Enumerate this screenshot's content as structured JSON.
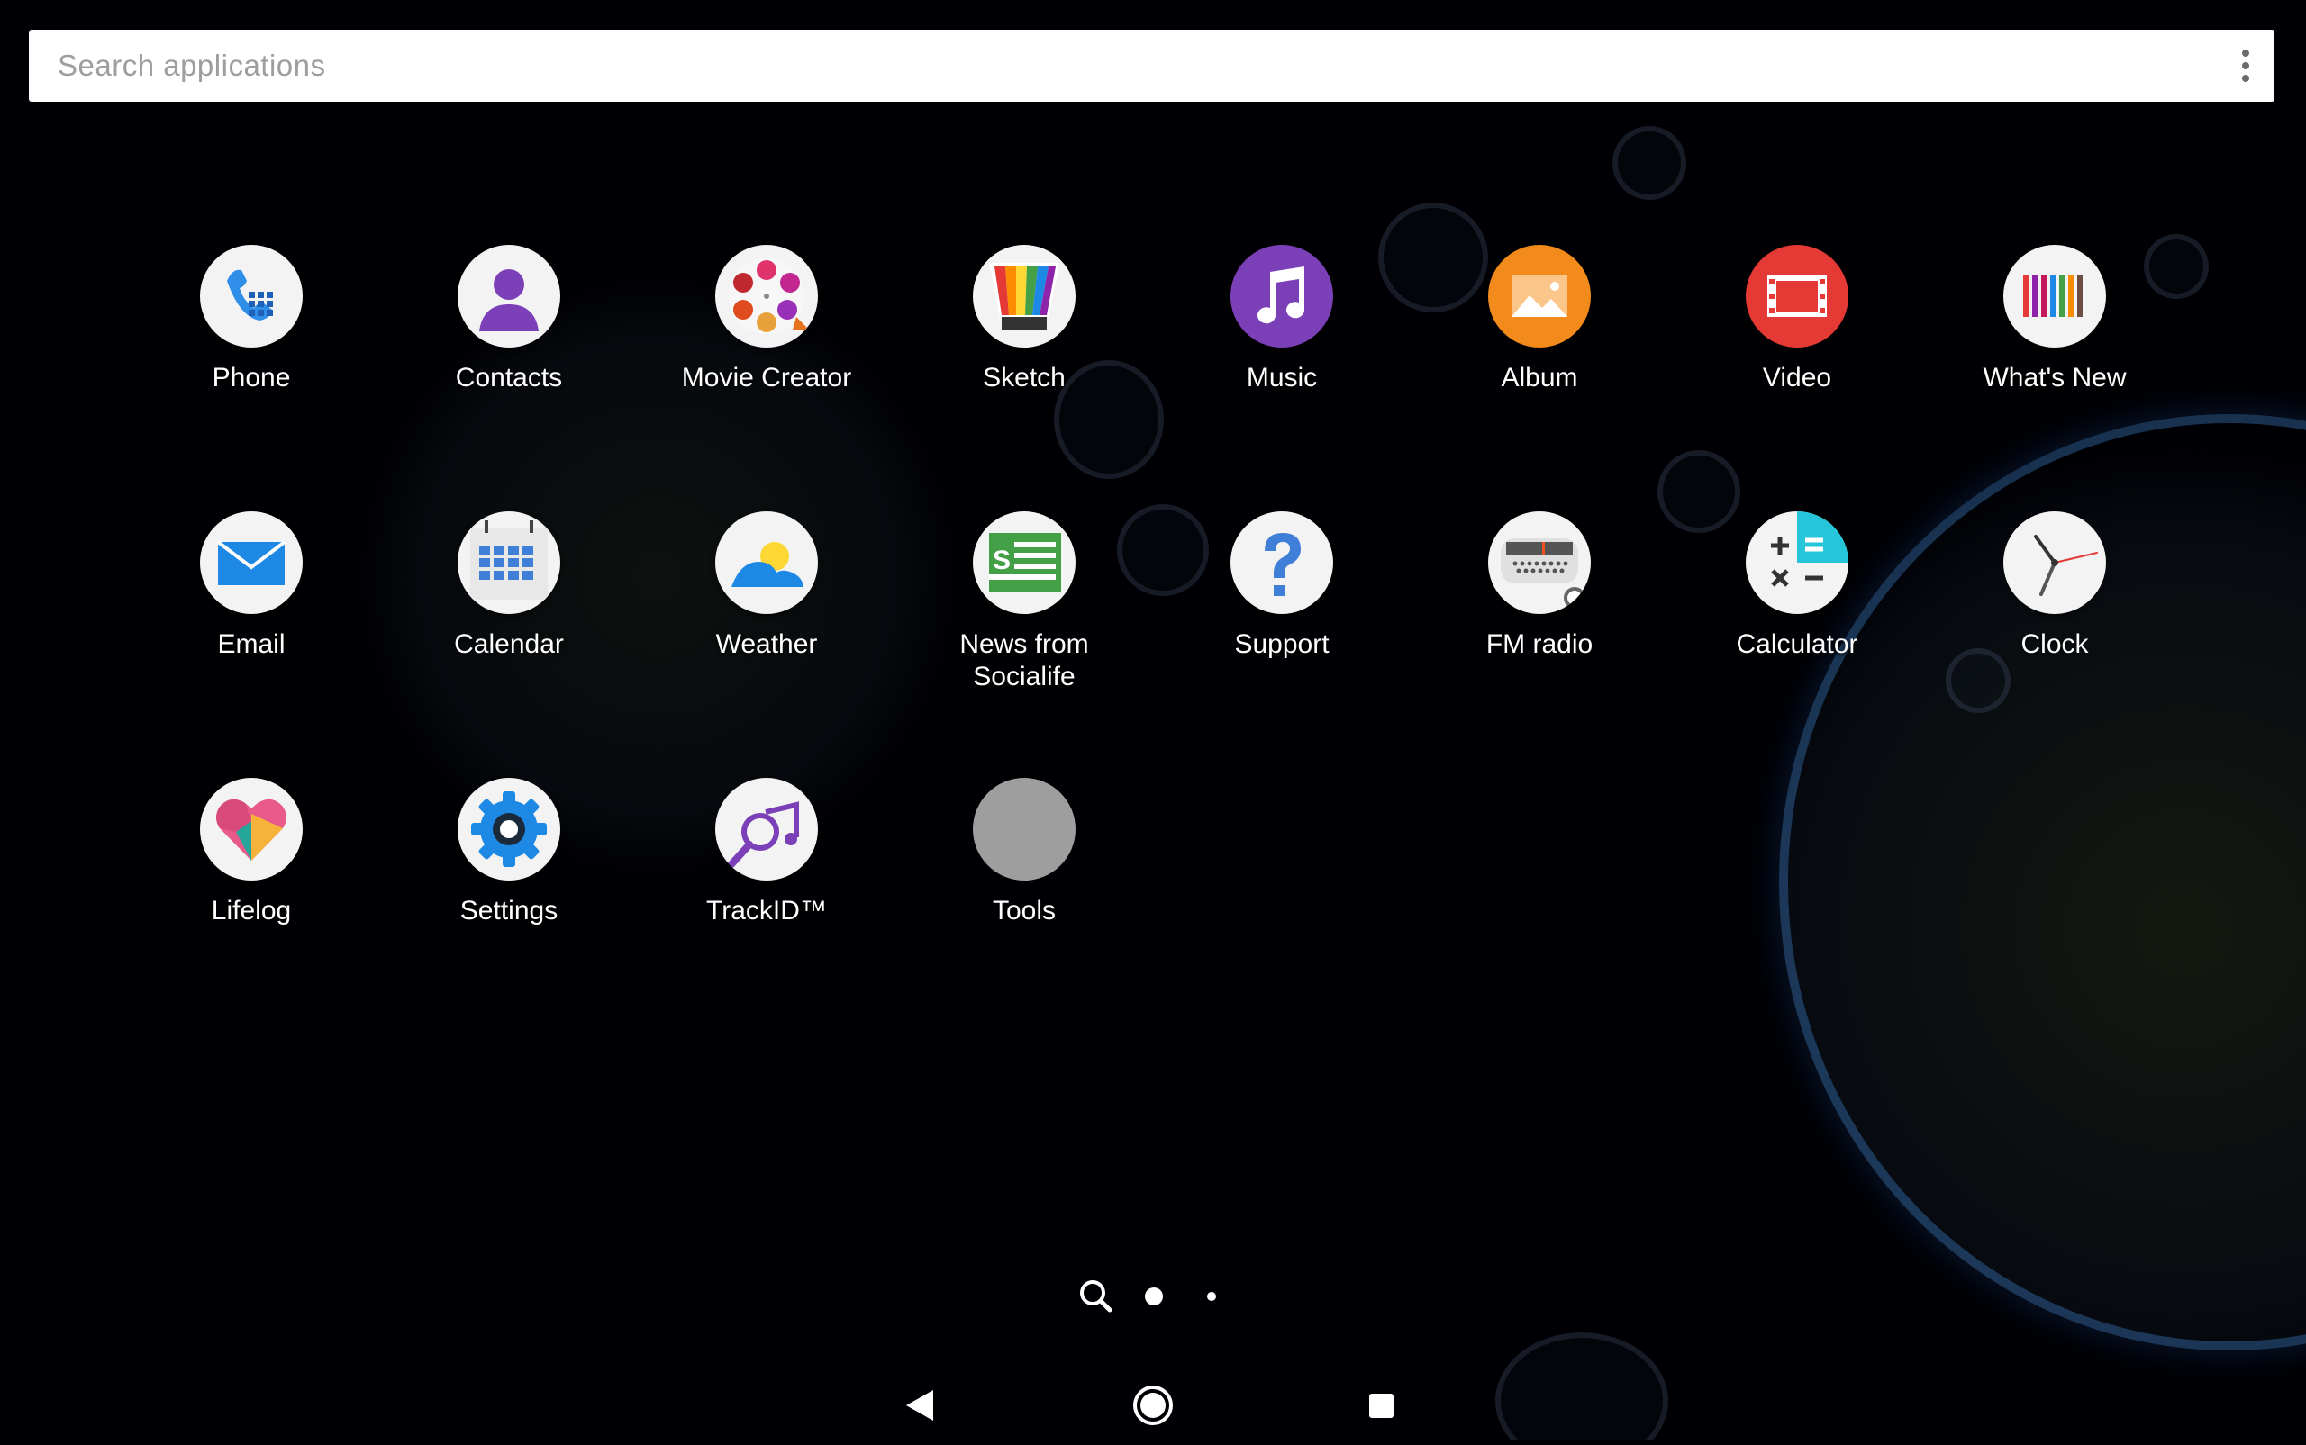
{
  "search": {
    "placeholder": "Search applications"
  },
  "apps": [
    {
      "label": "Phone",
      "icon": "phone-icon"
    },
    {
      "label": "Contacts",
      "icon": "contacts-icon"
    },
    {
      "label": "Movie Creator",
      "icon": "movie-creator-icon"
    },
    {
      "label": "Sketch",
      "icon": "sketch-icon"
    },
    {
      "label": "Music",
      "icon": "music-icon"
    },
    {
      "label": "Album",
      "icon": "album-icon"
    },
    {
      "label": "Video",
      "icon": "video-icon"
    },
    {
      "label": "What's New",
      "icon": "whats-new-icon"
    },
    {
      "label": "Email",
      "icon": "email-icon"
    },
    {
      "label": "Calendar",
      "icon": "calendar-icon"
    },
    {
      "label": "Weather",
      "icon": "weather-icon"
    },
    {
      "label": "News from Socialife",
      "icon": "news-socialife-icon"
    },
    {
      "label": "Support",
      "icon": "support-icon"
    },
    {
      "label": "FM radio",
      "icon": "fm-radio-icon"
    },
    {
      "label": "Calculator",
      "icon": "calculator-icon"
    },
    {
      "label": "Clock",
      "icon": "clock-icon"
    },
    {
      "label": "Lifelog",
      "icon": "lifelog-icon"
    },
    {
      "label": "Settings",
      "icon": "settings-icon"
    },
    {
      "label": "TrackID™",
      "icon": "trackid-icon"
    },
    {
      "label": "Tools",
      "icon": "folder-icon"
    }
  ],
  "page_indicator": {
    "pages": 2,
    "current": 1
  },
  "navigation": {
    "buttons": [
      "back",
      "home",
      "recents"
    ]
  },
  "colors": {
    "background": "#000004",
    "search_bar": "#ffffff",
    "placeholder": "#9e9e9e",
    "label": "#ffffff"
  }
}
